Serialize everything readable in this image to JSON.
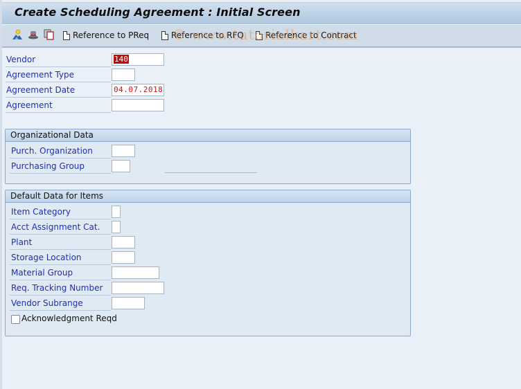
{
  "title": "Create Scheduling Agreement : Initial Screen",
  "toolbar": {
    "icons": [
      "vendor-person-icon",
      "hat-icon",
      "copy-icon"
    ],
    "buttons": [
      {
        "label": "Reference to PReq",
        "icon": "document-icon"
      },
      {
        "label": "Reference to RFQ",
        "icon": "document-icon"
      },
      {
        "label": "Reference to Contract",
        "icon": "document-icon"
      }
    ]
  },
  "watermark": "© www.tutorialkart.com",
  "header_fields": [
    {
      "label": "Vendor",
      "value": "140"
    },
    {
      "label": "Agreement Type",
      "value": ""
    },
    {
      "label": "Agreement Date",
      "value": "04.07.2018"
    },
    {
      "label": "Agreement",
      "value": ""
    }
  ],
  "org_data": {
    "title": "Organizational Data",
    "fields": [
      {
        "label": "Purch. Organization",
        "value": ""
      },
      {
        "label": "Purchasing Group",
        "value": ""
      }
    ]
  },
  "default_data": {
    "title": "Default Data for Items",
    "fields": [
      {
        "label": "Item Category",
        "value": ""
      },
      {
        "label": "Acct Assignment Cat.",
        "value": ""
      },
      {
        "label": "Plant",
        "value": ""
      },
      {
        "label": "Storage Location",
        "value": ""
      },
      {
        "label": "Material Group",
        "value": ""
      },
      {
        "label": "Req. Tracking Number",
        "value": ""
      },
      {
        "label": "Vendor Subrange",
        "value": ""
      }
    ],
    "checkbox": {
      "label": "Acknowledgment Reqd",
      "checked": false
    }
  }
}
